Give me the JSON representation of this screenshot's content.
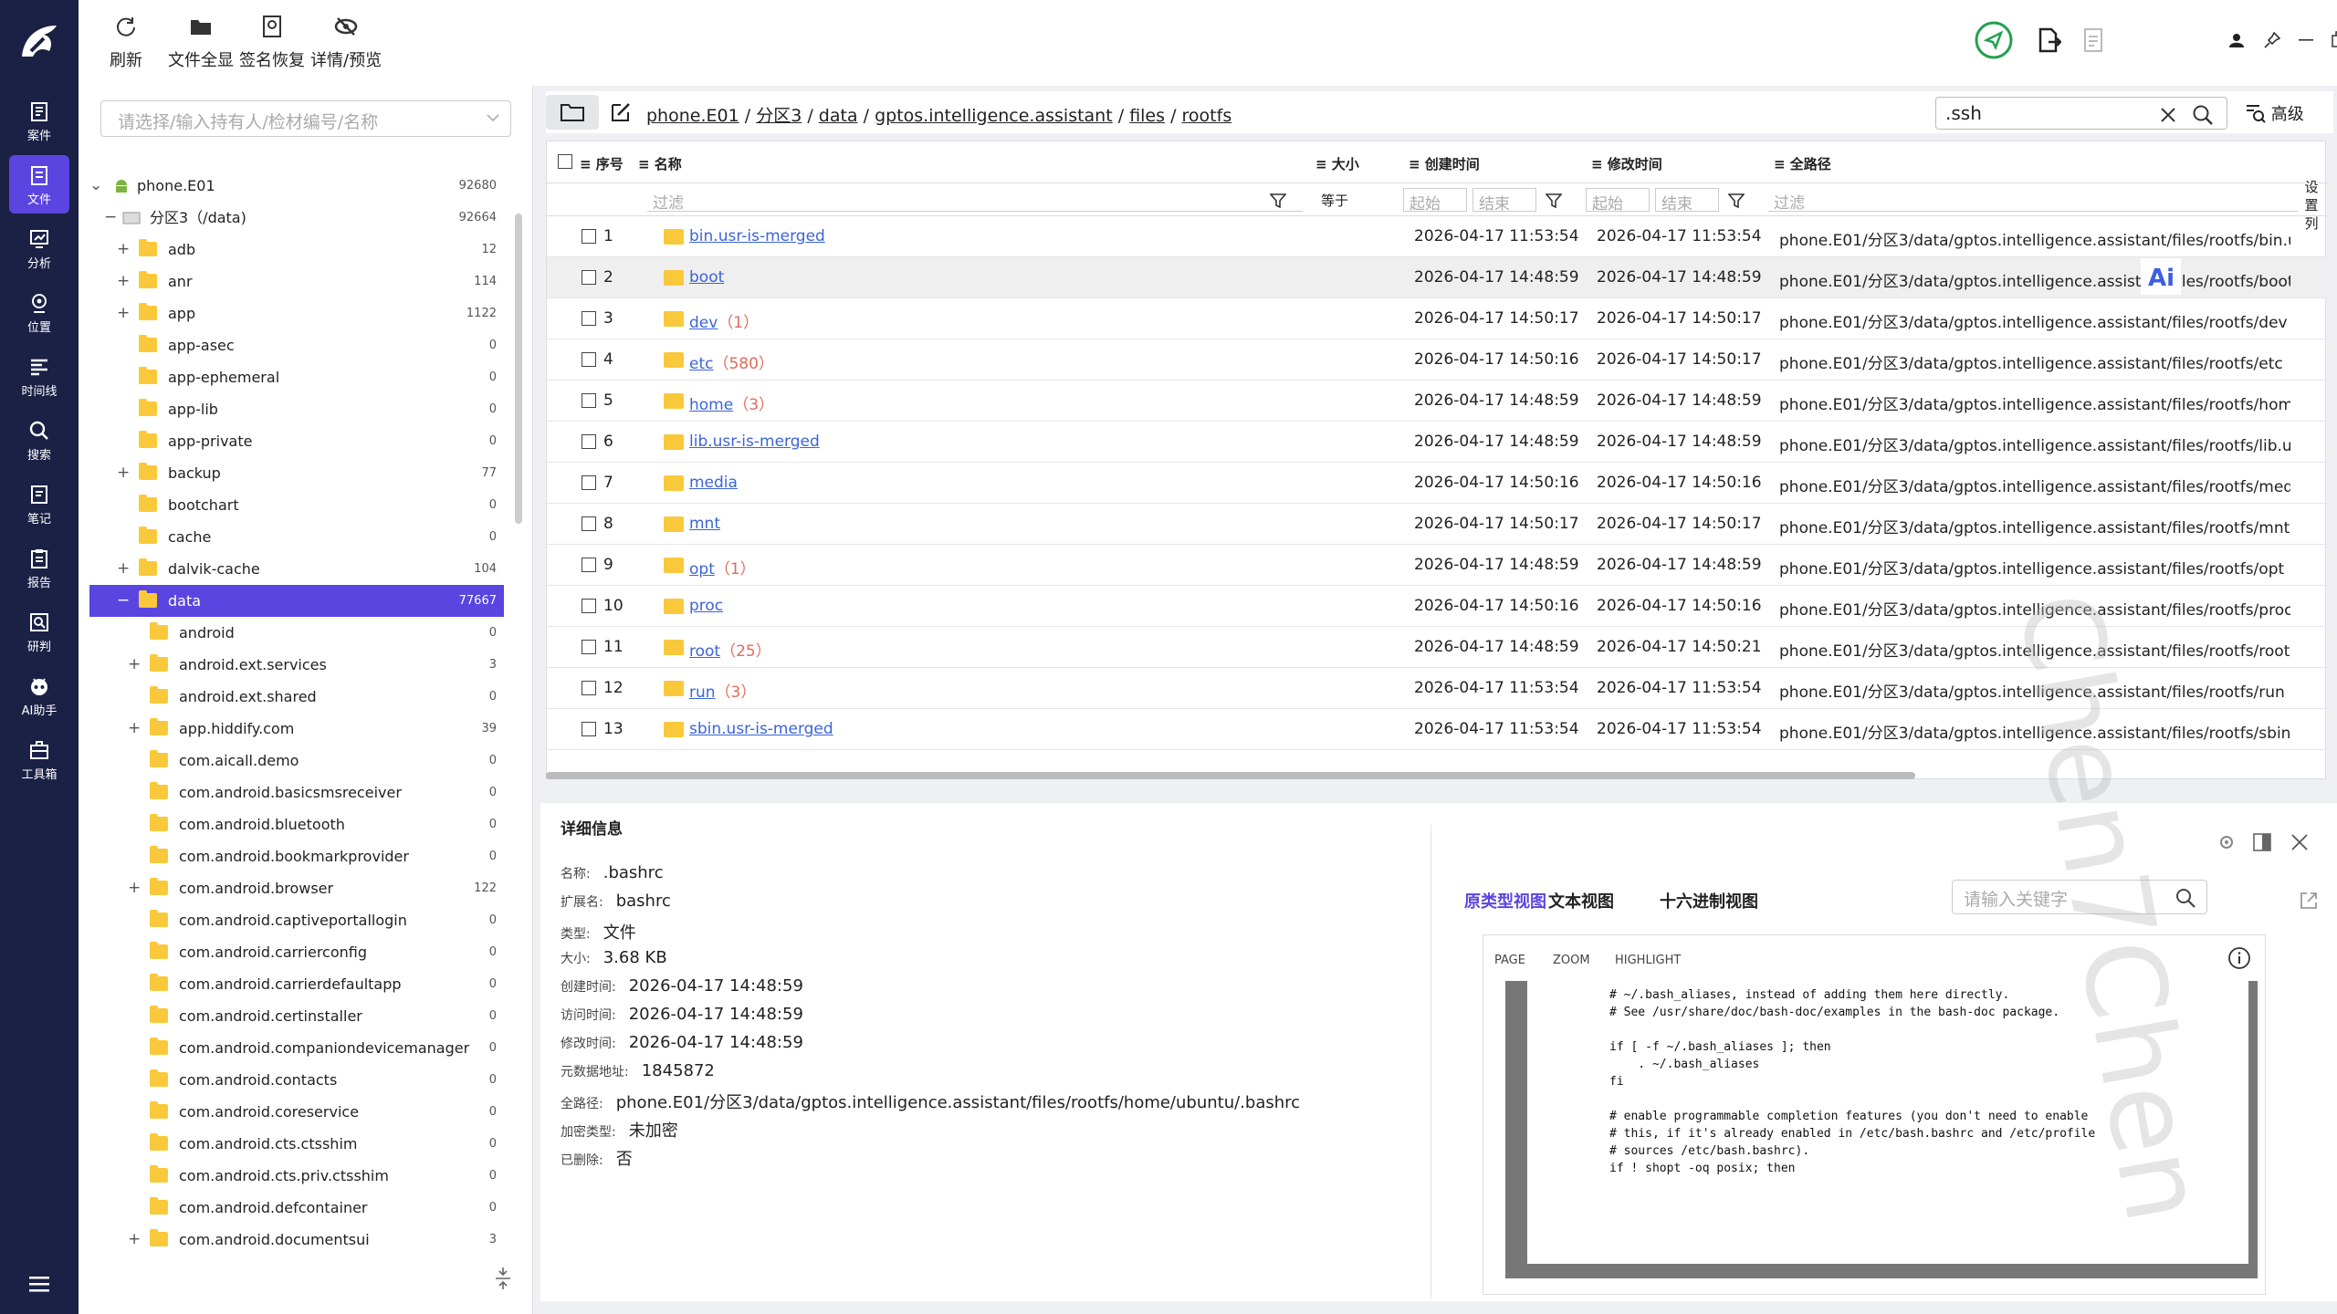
{
  "nav": [
    {
      "label": "案件",
      "icon": "case-icon"
    },
    {
      "label": "文件",
      "icon": "file-icon"
    },
    {
      "label": "分析",
      "icon": "analysis-icon"
    },
    {
      "label": "位置",
      "icon": "location-icon"
    },
    {
      "label": "时间线",
      "icon": "timeline-icon"
    },
    {
      "label": "搜索",
      "icon": "search-icon"
    },
    {
      "label": "笔记",
      "icon": "note-icon"
    },
    {
      "label": "报告",
      "icon": "report-icon"
    },
    {
      "label": "研判",
      "icon": "judge-icon"
    },
    {
      "label": "AI助手",
      "icon": "ai-assistant-icon"
    },
    {
      "label": "工具箱",
      "icon": "toolbox-icon"
    }
  ],
  "toolbar": {
    "refresh": "刷新",
    "all": "文件全显",
    "sign": "签名恢复",
    "preview": "详情/预览"
  },
  "tree": {
    "placeholder": "请选择/输入持有人/检材编号/名称",
    "rows": [
      {
        "name": "phone.E01",
        "count": "92680",
        "tog": "⌄"
      },
      {
        "name": "分区3（/data)",
        "count": "92664",
        "tog": "−"
      },
      {
        "name": "adb",
        "count": "12",
        "tog": "+"
      },
      {
        "name": "anr",
        "count": "114",
        "tog": "+"
      },
      {
        "name": "app",
        "count": "1122",
        "tog": "+"
      },
      {
        "name": "app-asec",
        "count": "0",
        "tog": ""
      },
      {
        "name": "app-ephemeral",
        "count": "0",
        "tog": ""
      },
      {
        "name": "app-lib",
        "count": "0",
        "tog": ""
      },
      {
        "name": "app-private",
        "count": "0",
        "tog": ""
      },
      {
        "name": "backup",
        "count": "77",
        "tog": "+"
      },
      {
        "name": "bootchart",
        "count": "0",
        "tog": ""
      },
      {
        "name": "cache",
        "count": "0",
        "tog": ""
      },
      {
        "name": "dalvik-cache",
        "count": "104",
        "tog": "+"
      },
      {
        "name": "data",
        "count": "77667",
        "tog": "−"
      },
      {
        "name": "android",
        "count": "0",
        "tog": ""
      },
      {
        "name": "android.ext.services",
        "count": "3",
        "tog": "+"
      },
      {
        "name": "android.ext.shared",
        "count": "0",
        "tog": ""
      },
      {
        "name": "app.hiddify.com",
        "count": "39",
        "tog": "+"
      },
      {
        "name": "com.aicall.demo",
        "count": "0",
        "tog": ""
      },
      {
        "name": "com.android.basicsmsreceiver",
        "count": "0",
        "tog": ""
      },
      {
        "name": "com.android.bluetooth",
        "count": "0",
        "tog": ""
      },
      {
        "name": "com.android.bookmarkprovider",
        "count": "0",
        "tog": ""
      },
      {
        "name": "com.android.browser",
        "count": "122",
        "tog": "+"
      },
      {
        "name": "com.android.captiveportallogin",
        "count": "0",
        "tog": ""
      },
      {
        "name": "com.android.carrierconfig",
        "count": "0",
        "tog": ""
      },
      {
        "name": "com.android.carrierdefaultapp",
        "count": "0",
        "tog": ""
      },
      {
        "name": "com.android.certinstaller",
        "count": "0",
        "tog": ""
      },
      {
        "name": "com.android.companiondevicemanager",
        "count": "0",
        "tog": ""
      },
      {
        "name": "com.android.contacts",
        "count": "0",
        "tog": ""
      },
      {
        "name": "com.android.coreservice",
        "count": "0",
        "tog": ""
      },
      {
        "name": "com.android.cts.ctsshim",
        "count": "0",
        "tog": ""
      },
      {
        "name": "com.android.cts.priv.ctsshim",
        "count": "0",
        "tog": ""
      },
      {
        "name": "com.android.defcontainer",
        "count": "0",
        "tog": ""
      },
      {
        "name": "com.android.documentsui",
        "count": "3",
        "tog": "+"
      }
    ]
  },
  "path": {
    "p1": "phone.E01",
    "p2": "分区3",
    "p3": "data",
    "p4": "gptos.intelligence.assistant",
    "p5": "files",
    "p6": "rootfs",
    "sep": "/"
  },
  "search": {
    "value": ".ssh",
    "advanced": "高级"
  },
  "table": {
    "headers": {
      "seq": "序号",
      "name": "名称",
      "size": "大小",
      "ctime": "创建时间",
      "mtime": "修改时间",
      "path": "全路径"
    },
    "filter": {
      "name": "过滤",
      "size": "等于",
      "start": "起始",
      "end": "结束",
      "path": "过滤"
    },
    "side": "设置列",
    "rows": [
      {
        "n": "1",
        "name": "bin.usr-is-merged",
        "cnt": "",
        "c": "2026-04-17 11:53:54",
        "m": "2026-04-17 11:53:54",
        "p": "phone.E01/分区3/data/gptos.intelligence.assistant/files/rootfs/bin.usr-is-m"
      },
      {
        "n": "2",
        "name": "boot",
        "cnt": "",
        "c": "2026-04-17 14:48:59",
        "m": "2026-04-17 14:48:59",
        "p": "phone.E01/分区3/data/gptos.intelligence.assistant/files/rootfs/boot"
      },
      {
        "n": "3",
        "name": "dev",
        "cnt": "（1）",
        "c": "2026-04-17 14:50:17",
        "m": "2026-04-17 14:50:17",
        "p": "phone.E01/分区3/data/gptos.intelligence.assistant/files/rootfs/dev"
      },
      {
        "n": "4",
        "name": "etc",
        "cnt": "（580）",
        "c": "2026-04-17 14:50:16",
        "m": "2026-04-17 14:50:17",
        "p": "phone.E01/分区3/data/gptos.intelligence.assistant/files/rootfs/etc"
      },
      {
        "n": "5",
        "name": "home",
        "cnt": "（3）",
        "c": "2026-04-17 14:48:59",
        "m": "2026-04-17 14:48:59",
        "p": "phone.E01/分区3/data/gptos.intelligence.assistant/files/rootfs/home"
      },
      {
        "n": "6",
        "name": "lib.usr-is-merged",
        "cnt": "",
        "c": "2026-04-17 14:48:59",
        "m": "2026-04-17 14:48:59",
        "p": "phone.E01/分区3/data/gptos.intelligence.assistant/files/rootfs/lib.usr-is-m"
      },
      {
        "n": "7",
        "name": "media",
        "cnt": "",
        "c": "2026-04-17 14:50:16",
        "m": "2026-04-17 14:50:16",
        "p": "phone.E01/分区3/data/gptos.intelligence.assistant/files/rootfs/media"
      },
      {
        "n": "8",
        "name": "mnt",
        "cnt": "",
        "c": "2026-04-17 14:50:17",
        "m": "2026-04-17 14:50:17",
        "p": "phone.E01/分区3/data/gptos.intelligence.assistant/files/rootfs/mnt"
      },
      {
        "n": "9",
        "name": "opt",
        "cnt": "（1）",
        "c": "2026-04-17 14:48:59",
        "m": "2026-04-17 14:48:59",
        "p": "phone.E01/分区3/data/gptos.intelligence.assistant/files/rootfs/opt"
      },
      {
        "n": "10",
        "name": "proc",
        "cnt": "",
        "c": "2026-04-17 14:50:16",
        "m": "2026-04-17 14:50:16",
        "p": "phone.E01/分区3/data/gptos.intelligence.assistant/files/rootfs/proc"
      },
      {
        "n": "11",
        "name": "root",
        "cnt": "（25）",
        "c": "2026-04-17 14:48:59",
        "m": "2026-04-17 14:50:21",
        "p": "phone.E01/分区3/data/gptos.intelligence.assistant/files/rootfs/root"
      },
      {
        "n": "12",
        "name": "run",
        "cnt": "（3）",
        "c": "2026-04-17 11:53:54",
        "m": "2026-04-17 11:53:54",
        "p": "phone.E01/分区3/data/gptos.intelligence.assistant/files/rootfs/run"
      },
      {
        "n": "13",
        "name": "sbin.usr-is-merged",
        "cnt": "",
        "c": "2026-04-17 11:53:54",
        "m": "2026-04-17 11:53:54",
        "p": "phone.E01/分区3/data/gptos.intelligence.assistant/files/rootfs/sbin.usr-is-r"
      }
    ]
  },
  "detail": {
    "title": "详细信息",
    "fields": [
      {
        "k": "名称:",
        "v": ".bashrc"
      },
      {
        "k": "扩展名:",
        "v": "bashrc"
      },
      {
        "k": "类型:",
        "v": "文件"
      },
      {
        "k": "大小:",
        "v": "3.68 KB"
      },
      {
        "k": "创建时间:",
        "v": "2026-04-17 14:48:59"
      },
      {
        "k": "访问时间:",
        "v": "2026-04-17 14:48:59"
      },
      {
        "k": "修改时间:",
        "v": "2026-04-17 14:48:59"
      },
      {
        "k": "元数据地址:",
        "v": "1845872"
      },
      {
        "k": "全路径:",
        "v": "phone.E01/分区3/data/gptos.intelligence.assistant/files/rootfs/home/ubuntu/.bashrc"
      },
      {
        "k": "加密类型:",
        "v": "未加密"
      },
      {
        "k": "已删除:",
        "v": "否"
      }
    ]
  },
  "viewer": {
    "tabs": [
      "原类型视图",
      "文本视图",
      "十六进制视图"
    ],
    "keyword_placeholder": "请输入关键字",
    "pdf_tabs": [
      "PAGE",
      "ZOOM",
      "HIGHLIGHT"
    ],
    "code": "# ~/.bash_aliases, instead of adding them here directly.\n# See /usr/share/doc/bash-doc/examples in the bash-doc package.\n\nif [ -f ~/.bash_aliases ]; then\n    . ~/.bash_aliases\nfi\n\n# enable programmable completion features (you don't need to enable\n# this, if it's already enabled in /etc/bash.bashrc and /etc/profile\n# sources /etc/bash.bashrc).\nif ! shopt -oq posix; then"
  },
  "watermark": "Chen7Chen"
}
